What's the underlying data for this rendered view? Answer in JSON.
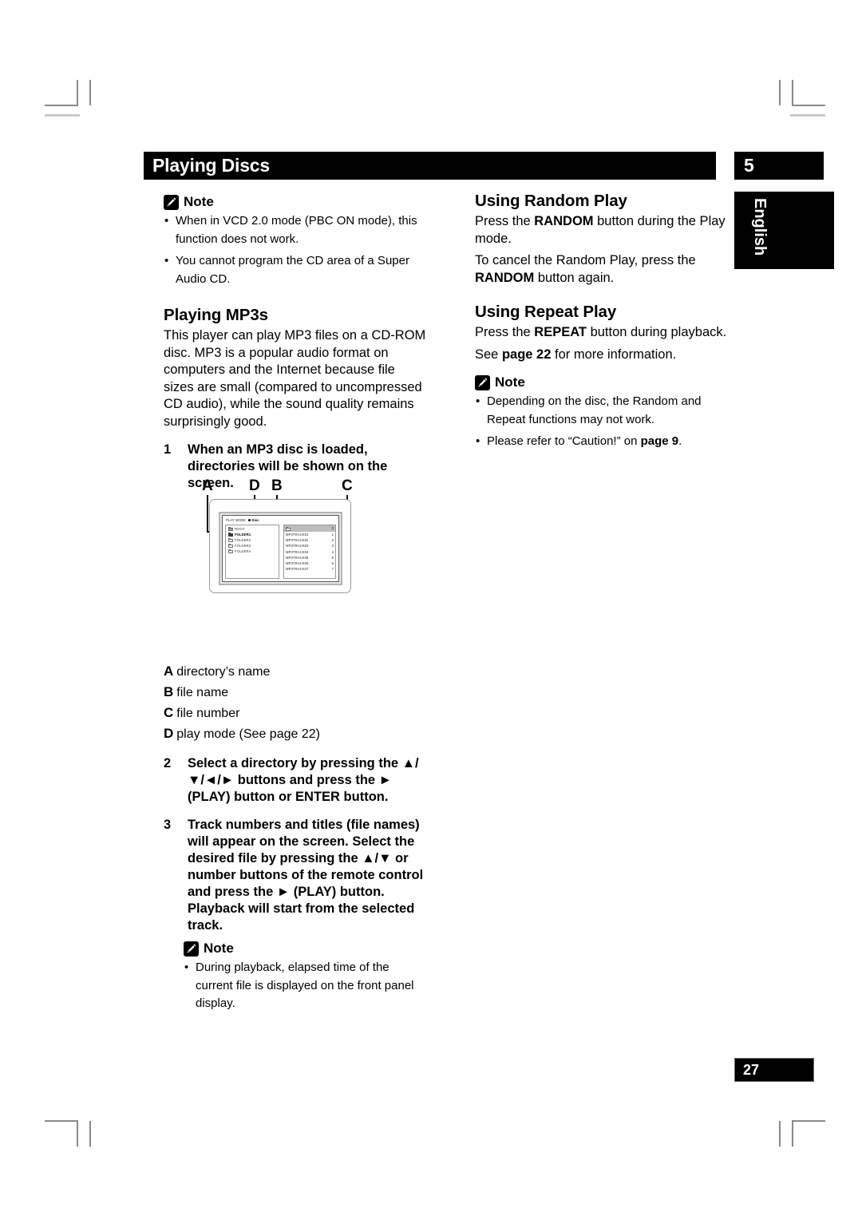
{
  "header": {
    "chapter_title": "Playing Discs",
    "chapter_number": "5",
    "language_tab": "English"
  },
  "footer": {
    "page_number": "27"
  },
  "left_column": {
    "note_top": {
      "label": "Note",
      "items": [
        "When in VCD 2.0 mode (PBC ON mode), this function does not work.",
        "You cannot program the CD area of a Super Audio CD."
      ]
    },
    "mp3_section": {
      "heading": "Playing MP3s",
      "intro": "This player can play MP3 files on a CD-ROM disc. MP3 is a popular audio format on computers and the Internet because file sizes are small (compared to uncompressed CD audio), while the sound quality remains surprisingly good.",
      "steps": [
        {
          "num": "1",
          "text": "When an MP3 disc is loaded, directories will be shown on the screen."
        },
        {
          "num": "2",
          "text": "Select a directory by pressing the ▲/▼/◄/► buttons and press the ► (PLAY) button or ENTER button."
        },
        {
          "num": "3",
          "text": "Track  numbers and titles (file names) will appear on the screen. Select the desired file by pressing the ▲/▼ or number buttons of the remote control and press the ► (PLAY) button. Playback will start from the selected track."
        }
      ]
    },
    "legend": [
      {
        "letter": "A",
        "text": "directory’s name"
      },
      {
        "letter": "B",
        "text": "file name"
      },
      {
        "letter": "C",
        "text": "file number"
      },
      {
        "letter": "D",
        "text": "play mode (See page 22)"
      }
    ],
    "note_bottom": {
      "label": "Note",
      "items": [
        "During playback, elapsed time of the current file is displayed on the front panel display."
      ]
    }
  },
  "screen_diagram": {
    "callouts": [
      "A",
      "D",
      "B",
      "C"
    ],
    "play_mode_label": "PLAY MODE :",
    "play_mode_value": "Disc",
    "directories": [
      {
        "name": "ROOT",
        "selected": false,
        "icon": "folder-gray-icon"
      },
      {
        "name": "FOLDER1",
        "selected": true,
        "icon": "folder-dark-icon"
      },
      {
        "name": "FOLDER2",
        "selected": false,
        "icon": "folder-icon"
      },
      {
        "name": "FOLDER3",
        "selected": false,
        "icon": "folder-icon"
      },
      {
        "name": "FOLDER4",
        "selected": false,
        "icon": "folder-icon"
      }
    ],
    "files": [
      {
        "name": "",
        "number": "0",
        "is_header": true
      },
      {
        "name": "MP3TRACK01",
        "number": "1",
        "is_header": false
      },
      {
        "name": "MP3TRACK02",
        "number": "2",
        "is_header": false
      },
      {
        "name": "MP3TRACK03",
        "number": "3",
        "is_header": false
      },
      {
        "name": "MP3TRACK04",
        "number": "4",
        "is_header": false
      },
      {
        "name": "MP3TRACK05",
        "number": "5",
        "is_header": false
      },
      {
        "name": "MP3TRACK06",
        "number": "6",
        "is_header": false
      },
      {
        "name": "MP3TRACK07",
        "number": "7",
        "is_header": false
      }
    ]
  },
  "right_column": {
    "random": {
      "heading": "Using Random Play",
      "para1_pre": "Press the ",
      "para1_bold": "RANDOM",
      "para1_post": " button during the Play mode.",
      "para2_pre": "To cancel the Random Play, press the ",
      "para2_bold": "RANDOM",
      "para2_post": " button again."
    },
    "repeat": {
      "heading": "Using Repeat Play",
      "para1_pre": "Press the ",
      "para1_bold": "REPEAT",
      "para1_post": " button during playback.",
      "para2_pre": "See ",
      "para2_bold": "page 22",
      "para2_post": " for more information."
    },
    "note": {
      "label": "Note",
      "item1": "Depending on the disc, the Random and Repeat functions may not work.",
      "item2_pre": "Please refer to “Caution!” on ",
      "item2_bold": "page 9",
      "item2_post": "."
    }
  }
}
